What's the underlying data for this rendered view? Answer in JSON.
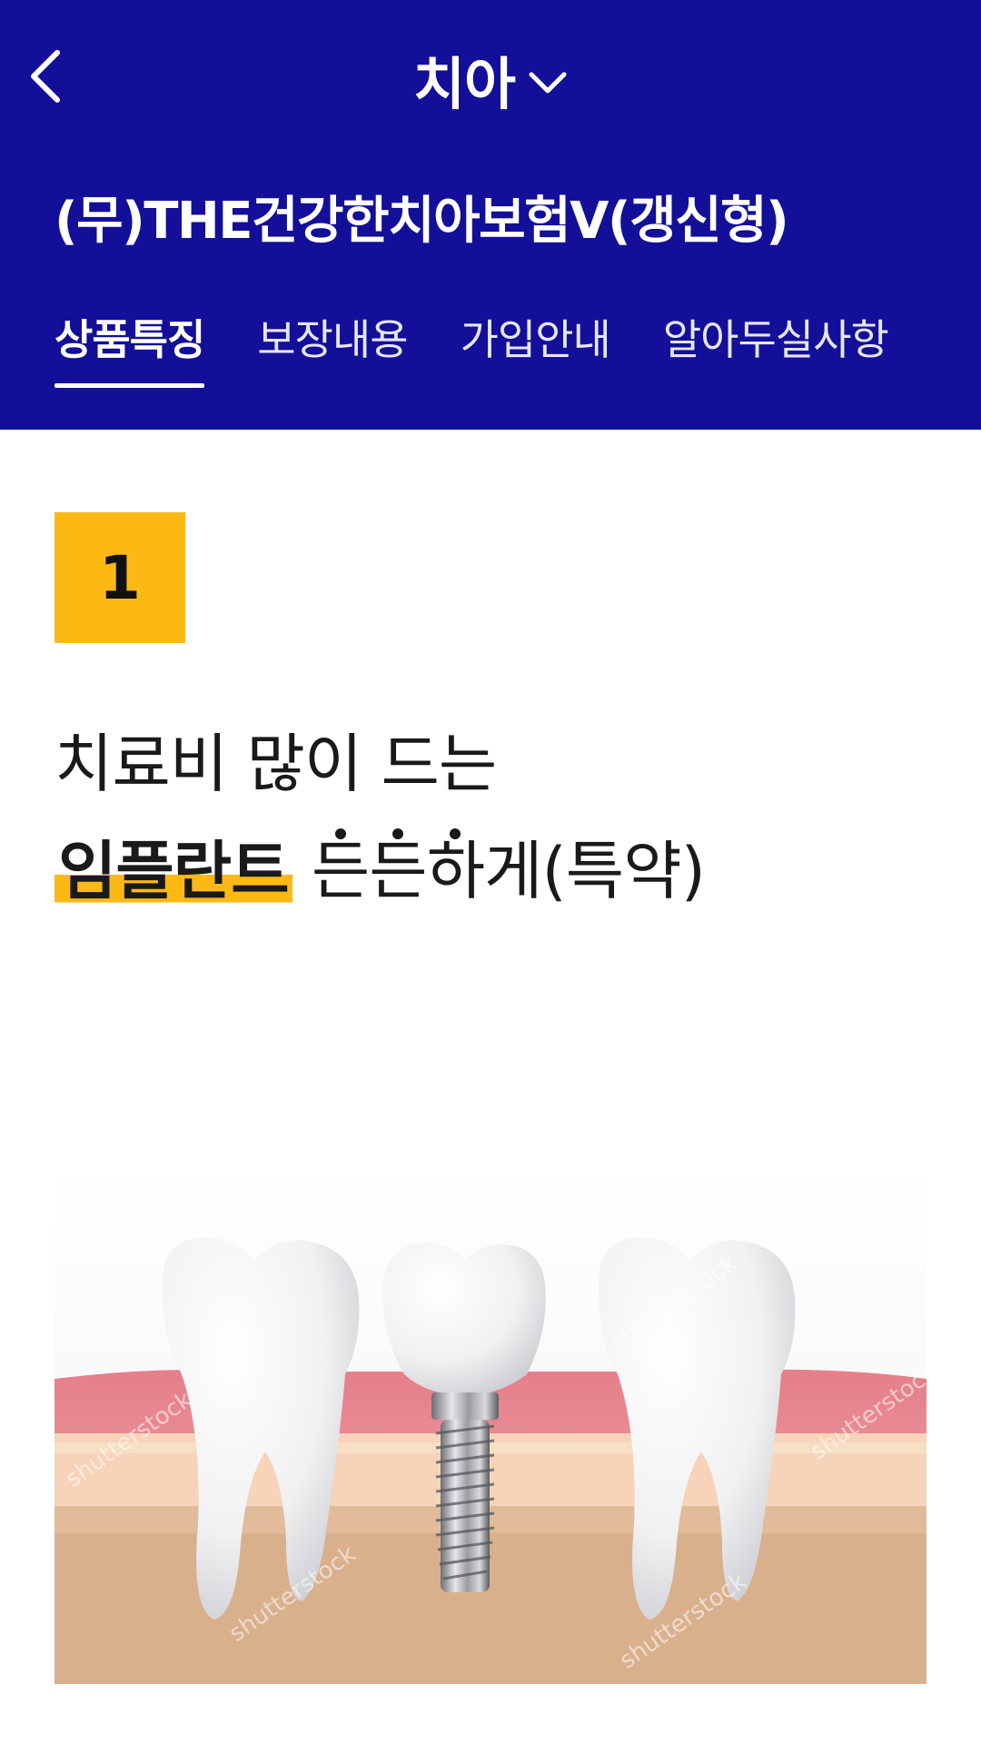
{
  "nav": {
    "title": "치아"
  },
  "product": {
    "name": "(무)THE건강한치아보험V(갱신형)"
  },
  "tabs": [
    {
      "label": "상품특징",
      "active": true
    },
    {
      "label": "보장내용",
      "active": false
    },
    {
      "label": "가입안내",
      "active": false
    },
    {
      "label": "알아두실사항",
      "active": false
    }
  ],
  "feature": {
    "number": "1",
    "line1": "치료비 많이 드는",
    "highlight": "임플란트",
    "emph_chars": [
      "든",
      "든",
      "하"
    ],
    "rest": "게(특약)"
  },
  "image": {
    "watermark": "shutterstock"
  },
  "colors": {
    "header_bg": "#130f98",
    "accent": "#fdb913"
  },
  "icons": {
    "back": "chevron-left-icon",
    "dropdown": "chevron-down-icon"
  }
}
